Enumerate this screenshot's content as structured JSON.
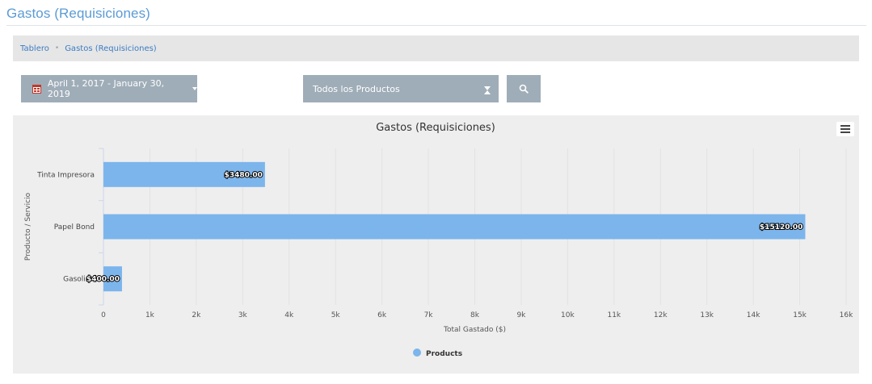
{
  "page": {
    "title": "Gastos (Requisiciones)"
  },
  "breadcrumb": {
    "items": [
      "Tablero",
      "Gastos (Requisiciones)"
    ]
  },
  "filters": {
    "date_range": "April 1, 2017 - January 30, 2019",
    "product_select": "Todos los Productos",
    "search_icon": "search-icon",
    "calendar_icon": "calendar-icon"
  },
  "chart_data": {
    "type": "bar",
    "orientation": "horizontal",
    "title": "Gastos (Requisiciones)",
    "xlabel": "Total Gastado ($)",
    "ylabel": "Producto / Servicio",
    "categories": [
      "Tinta Impresora",
      "Papel Bond",
      "Gasolina"
    ],
    "series": [
      {
        "name": "Products",
        "values": [
          3480,
          15120,
          400
        ],
        "labels": [
          "$3480.00",
          "$15120.00",
          "$400.00"
        ],
        "color": "#7cb5ec"
      }
    ],
    "xlim": [
      0,
      16000
    ],
    "xticks": [
      "0",
      "1k",
      "2k",
      "3k",
      "4k",
      "5k",
      "6k",
      "7k",
      "8k",
      "9k",
      "10k",
      "11k",
      "12k",
      "13k",
      "14k",
      "15k",
      "16k"
    ],
    "grid": true,
    "legend": "bottom-center",
    "menu_icon": "hamburger-menu-icon"
  }
}
